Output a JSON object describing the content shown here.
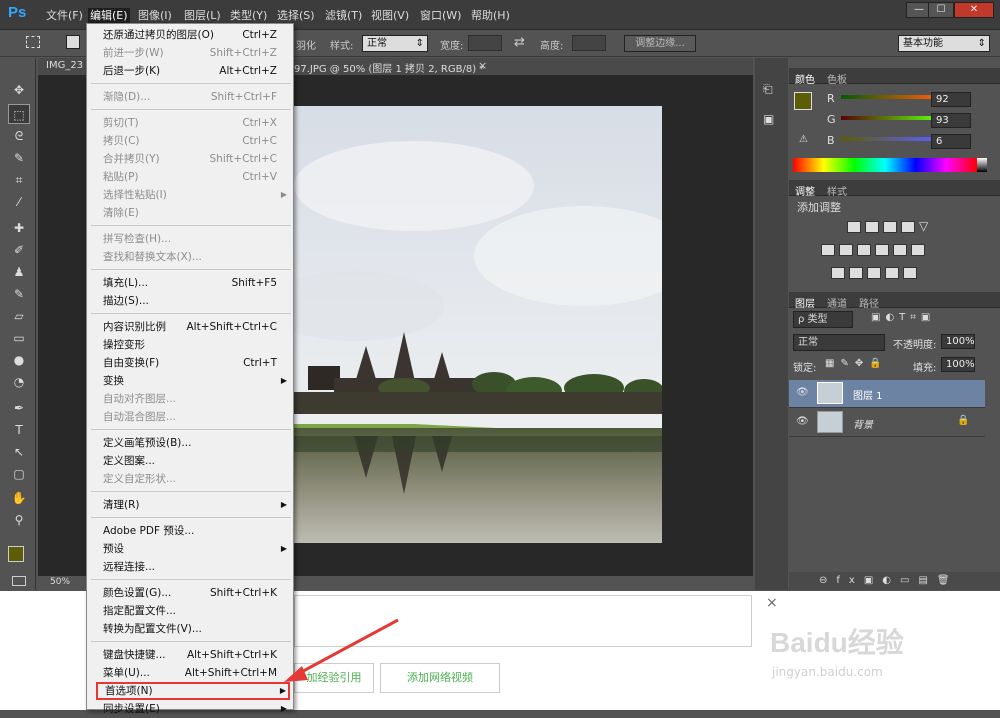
{
  "menubar": {
    "logo": "Ps",
    "items": [
      "文件(F)",
      "编辑(E)",
      "图像(I)",
      "图层(L)",
      "类型(Y)",
      "选择(S)",
      "滤镜(T)",
      "视图(V)",
      "窗口(W)",
      "帮助(H)"
    ],
    "window_buttons": [
      "—",
      "☐",
      "✕"
    ]
  },
  "options": {
    "feather_tail": "羽化",
    "style_label": "样式:",
    "style_value": "正常",
    "width_label": "宽度:",
    "height_label": "高度:",
    "refine_button": "调整边缘...",
    "workspace": "基本功能"
  },
  "document": {
    "tab_left": "IMG_23",
    "tab_right": "97.JPG @ 50% (图层 1 拷贝 2, RGB/8) *",
    "tab_close": "×",
    "zoom": "50%"
  },
  "color_panel": {
    "tabs": [
      "颜色",
      "色板"
    ],
    "r_label": "R",
    "r_value": "92",
    "g_label": "G",
    "g_value": "93",
    "b_label": "B",
    "b_value": "6",
    "swatch_color": "#5c5d06"
  },
  "adjust_panel": {
    "tabs": [
      "调整",
      "样式"
    ],
    "title": "添加调整"
  },
  "layers_panel": {
    "tabs": [
      "图层",
      "通道",
      "路径"
    ],
    "filter_label": "ρ 类型",
    "blend_mode": "正常",
    "opacity_label": "不透明度:",
    "opacity_value": "100%",
    "lock_label": "锁定:",
    "fill_label": "填充:",
    "fill_value": "100%",
    "layers": [
      {
        "name": "图层 1",
        "selected": true
      },
      {
        "name": "背景",
        "locked": true
      }
    ]
  },
  "edit_menu": [
    {
      "label": "还原通过拷贝的图层(O)",
      "shortcut": "Ctrl+Z",
      "enabled": true
    },
    {
      "label": "前进一步(W)",
      "shortcut": "Shift+Ctrl+Z",
      "enabled": false
    },
    {
      "label": "后退一步(K)",
      "shortcut": "Alt+Ctrl+Z",
      "enabled": true
    },
    {
      "sep": true
    },
    {
      "label": "渐隐(D)...",
      "shortcut": "Shift+Ctrl+F",
      "enabled": false
    },
    {
      "sep": true
    },
    {
      "label": "剪切(T)",
      "shortcut": "Ctrl+X",
      "enabled": false
    },
    {
      "label": "拷贝(C)",
      "shortcut": "Ctrl+C",
      "enabled": false
    },
    {
      "label": "合并拷贝(Y)",
      "shortcut": "Shift+Ctrl+C",
      "enabled": false
    },
    {
      "label": "粘贴(P)",
      "shortcut": "Ctrl+V",
      "enabled": false
    },
    {
      "label": "选择性粘贴(I)",
      "shortcut": "",
      "enabled": false,
      "submenu": true
    },
    {
      "label": "清除(E)",
      "shortcut": "",
      "enabled": false
    },
    {
      "sep": true
    },
    {
      "label": "拼写检查(H)...",
      "shortcut": "",
      "enabled": false
    },
    {
      "label": "查找和替换文本(X)...",
      "shortcut": "",
      "enabled": false
    },
    {
      "sep": true
    },
    {
      "label": "填充(L)...",
      "shortcut": "Shift+F5",
      "enabled": true
    },
    {
      "label": "描边(S)...",
      "shortcut": "",
      "enabled": true
    },
    {
      "sep": true
    },
    {
      "label": "内容识别比例",
      "shortcut": "Alt+Shift+Ctrl+C",
      "enabled": true
    },
    {
      "label": "操控变形",
      "shortcut": "",
      "enabled": true
    },
    {
      "label": "自由变换(F)",
      "shortcut": "Ctrl+T",
      "enabled": true
    },
    {
      "label": "变换",
      "shortcut": "",
      "enabled": true,
      "submenu": true
    },
    {
      "label": "自动对齐图层...",
      "shortcut": "",
      "enabled": false
    },
    {
      "label": "自动混合图层...",
      "shortcut": "",
      "enabled": false
    },
    {
      "sep": true
    },
    {
      "label": "定义画笔预设(B)...",
      "shortcut": "",
      "enabled": true
    },
    {
      "label": "定义图案...",
      "shortcut": "",
      "enabled": true
    },
    {
      "label": "定义自定形状...",
      "shortcut": "",
      "enabled": false
    },
    {
      "sep": true
    },
    {
      "label": "清理(R)",
      "shortcut": "",
      "enabled": true,
      "submenu": true
    },
    {
      "sep": true
    },
    {
      "label": "Adobe PDF 预设...",
      "shortcut": "",
      "enabled": true
    },
    {
      "label": "预设",
      "shortcut": "",
      "enabled": true,
      "submenu": true
    },
    {
      "label": "远程连接...",
      "shortcut": "",
      "enabled": true
    },
    {
      "sep": true
    },
    {
      "label": "颜色设置(G)...",
      "shortcut": "Shift+Ctrl+K",
      "enabled": true
    },
    {
      "label": "指定配置文件...",
      "shortcut": "",
      "enabled": true
    },
    {
      "label": "转换为配置文件(V)...",
      "shortcut": "",
      "enabled": true
    },
    {
      "sep": true
    },
    {
      "label": "键盘快捷键...",
      "shortcut": "Alt+Shift+Ctrl+K",
      "enabled": true
    },
    {
      "label": "菜单(U)...",
      "shortcut": "Alt+Shift+Ctrl+M",
      "enabled": true
    },
    {
      "label": "首选项(N)",
      "shortcut": "",
      "enabled": true,
      "submenu": true,
      "highlighted": true
    },
    {
      "label": "同步设置(E)",
      "shortcut": "",
      "enabled": true,
      "submenu": true
    }
  ],
  "web": {
    "close": "×",
    "btn1": "加经验引用",
    "btn2": "添加网络视频",
    "watermark": "Baidu经验",
    "watermark_url": "jingyan.baidu.com"
  },
  "colors": {
    "highlight_box": "#e53935",
    "arrow": "#e53935"
  }
}
